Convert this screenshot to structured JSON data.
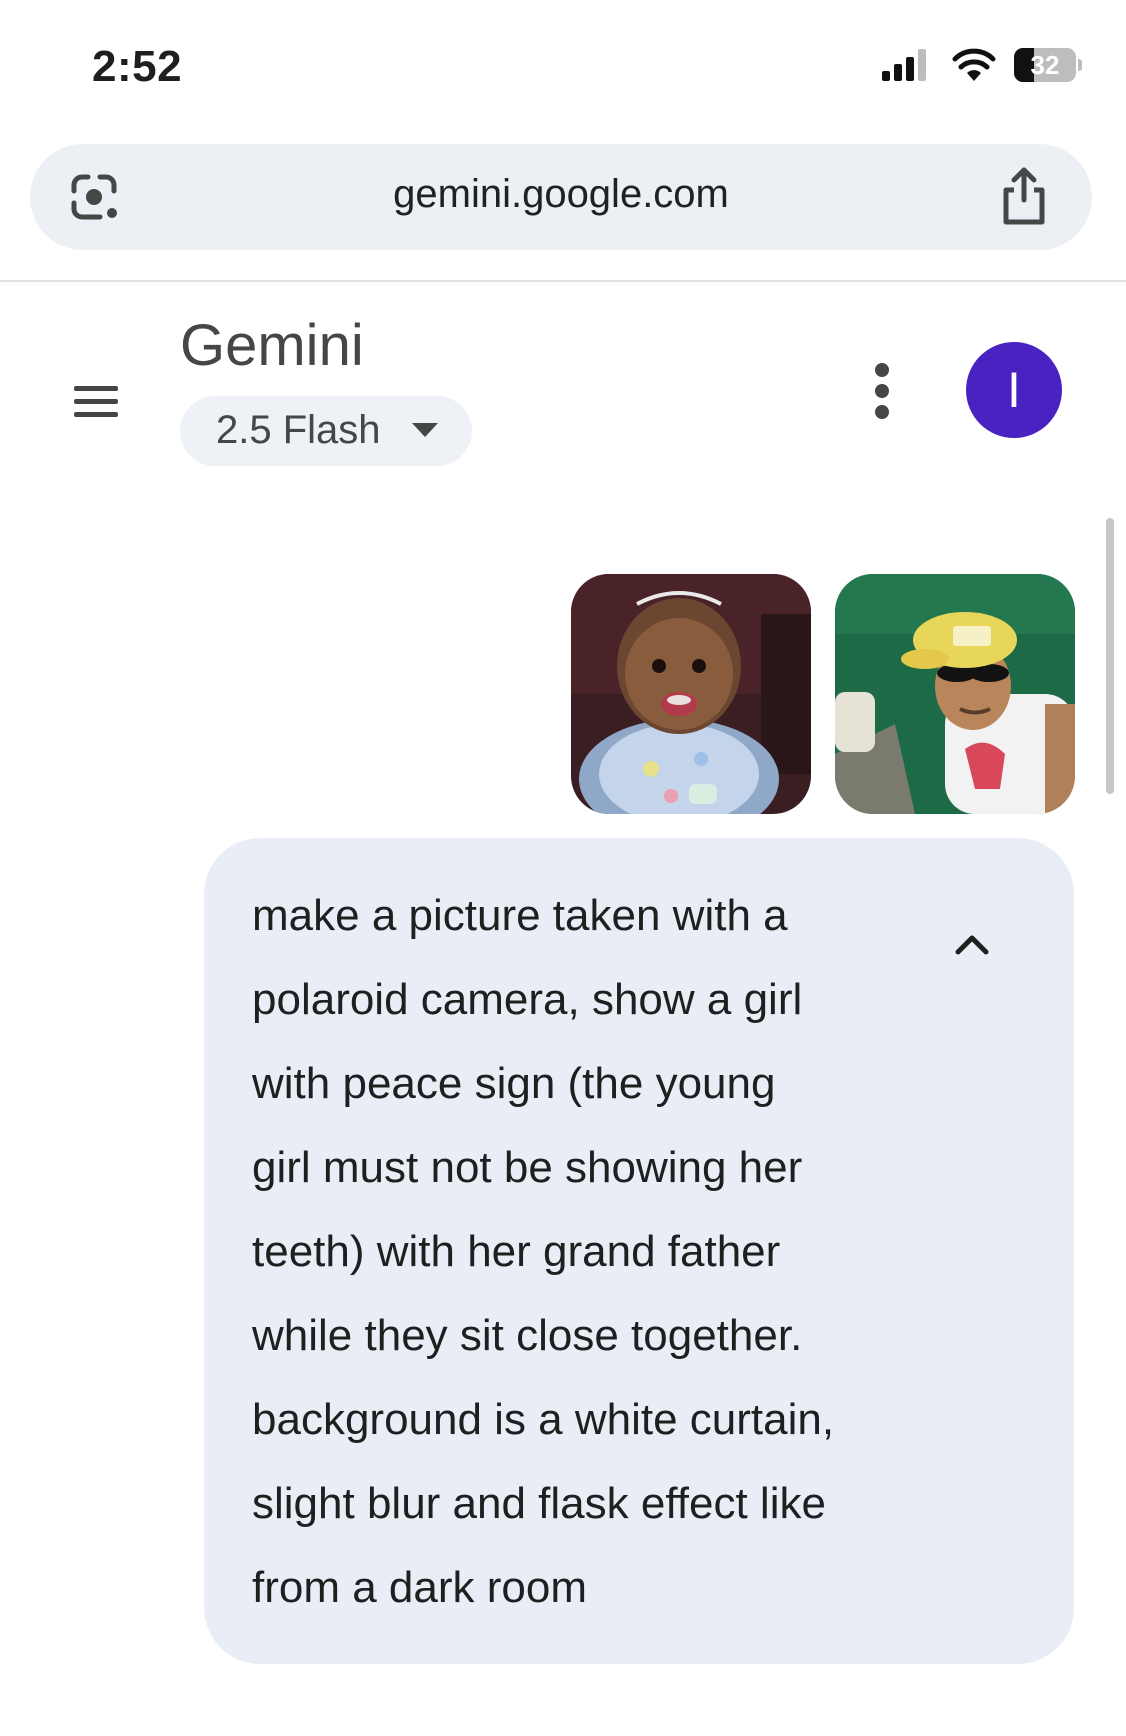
{
  "status_bar": {
    "time": "2:52",
    "battery_level": "32",
    "icons": [
      "cellular-signal-icon",
      "wifi-icon",
      "battery-icon"
    ]
  },
  "browser": {
    "url": "gemini.google.com",
    "icons": [
      "google-lens-icon",
      "share-icon"
    ]
  },
  "app_header": {
    "title": "Gemini",
    "model": "2.5 Flash",
    "avatar_initial": "I",
    "avatar_color": "#4a22c1",
    "icons": [
      "menu-icon",
      "caret-down-icon",
      "more-vert-icon"
    ]
  },
  "chat": {
    "attachments": [
      {
        "name": "baby-photo-thumbnail"
      },
      {
        "name": "grandfather-photo-thumbnail"
      }
    ],
    "prompt_lines": [
      "make a picture taken with a",
      "polaroid camera, show a girl",
      "with peace sign (the young",
      "girl must not be showing her",
      "teeth) with her grand father",
      "while they sit close together.",
      "background is a white curtain,",
      "slight blur and flask effect like",
      "from a dark room"
    ],
    "bubble_color": "#e9eef6",
    "collapse_icon": "chevron-up-icon"
  }
}
